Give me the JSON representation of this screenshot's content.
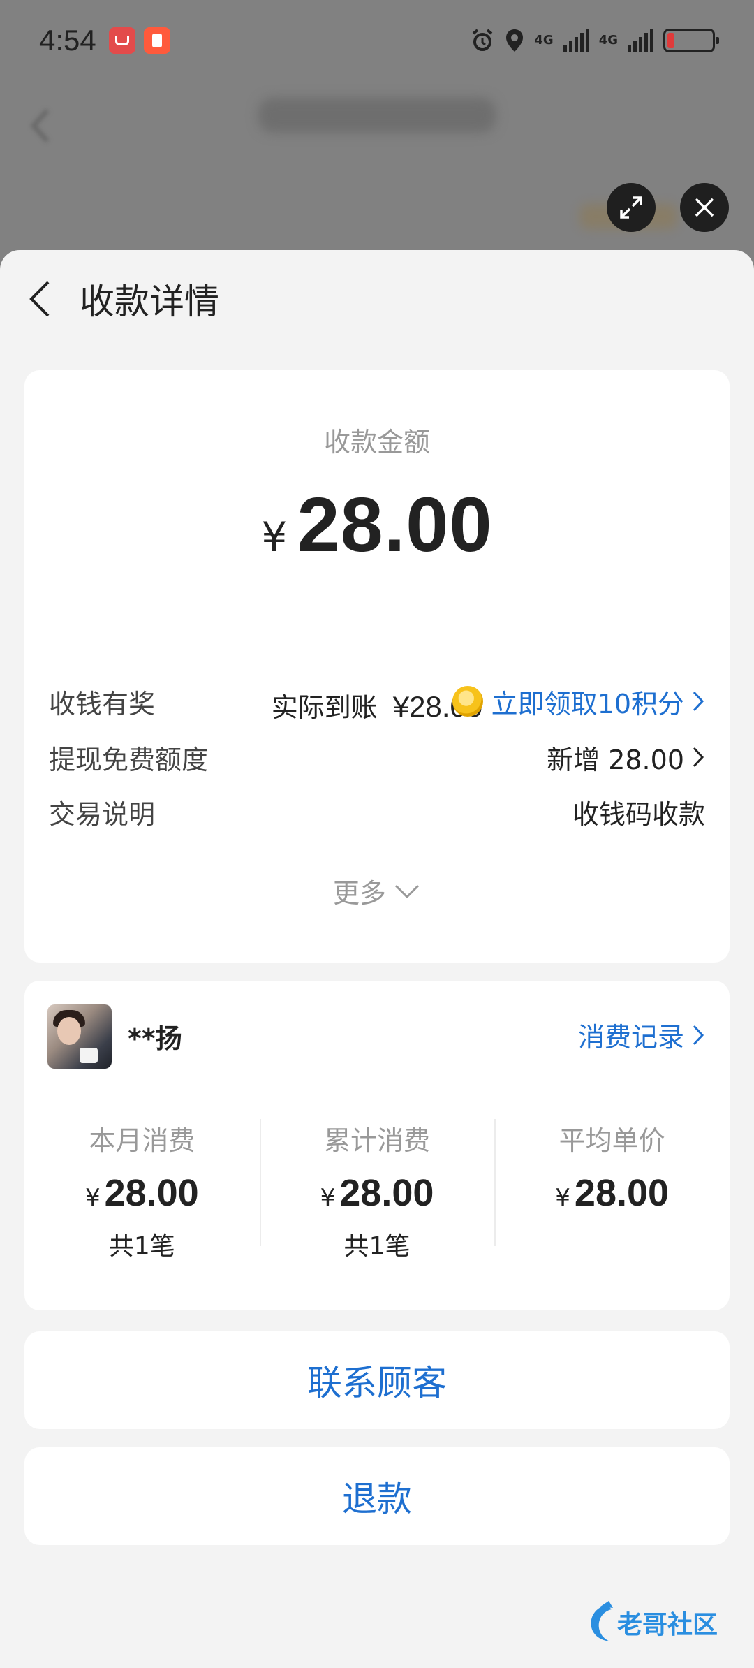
{
  "status_bar": {
    "time": "4:54",
    "apps": [
      "huawei-appgallery-icon",
      "app-notification-icon"
    ],
    "network_1": "4G",
    "network_2": "4G",
    "battery_color": "#e03a3a"
  },
  "header": {
    "title": "收款详情"
  },
  "summary": {
    "amount_label": "收款金额",
    "currency": "¥",
    "amount": "28.00",
    "actual_label": "实际到账",
    "actual_value": "¥28.00"
  },
  "details": [
    {
      "label": "收钱有奖",
      "value": "立即领取10积分"
    },
    {
      "label": "提现免费额度",
      "value": "新增 28.00"
    },
    {
      "label": "交易说明",
      "value": "收钱码收款"
    }
  ],
  "more_label": "更多",
  "customer": {
    "name": "**扬",
    "records_label": "消费记录",
    "stats": [
      {
        "title": "本月消费",
        "currency": "¥",
        "value": "28.00",
        "count": "共1笔"
      },
      {
        "title": "累计消费",
        "currency": "¥",
        "value": "28.00",
        "count": "共1笔"
      },
      {
        "title": "平均单价",
        "currency": "¥",
        "value": "28.00",
        "count": ""
      }
    ]
  },
  "actions": {
    "contact": "联系顾客",
    "refund": "退款"
  },
  "watermark": "老哥社区",
  "colors": {
    "accent": "#1e6fd0",
    "background": "#f3f3f3"
  }
}
